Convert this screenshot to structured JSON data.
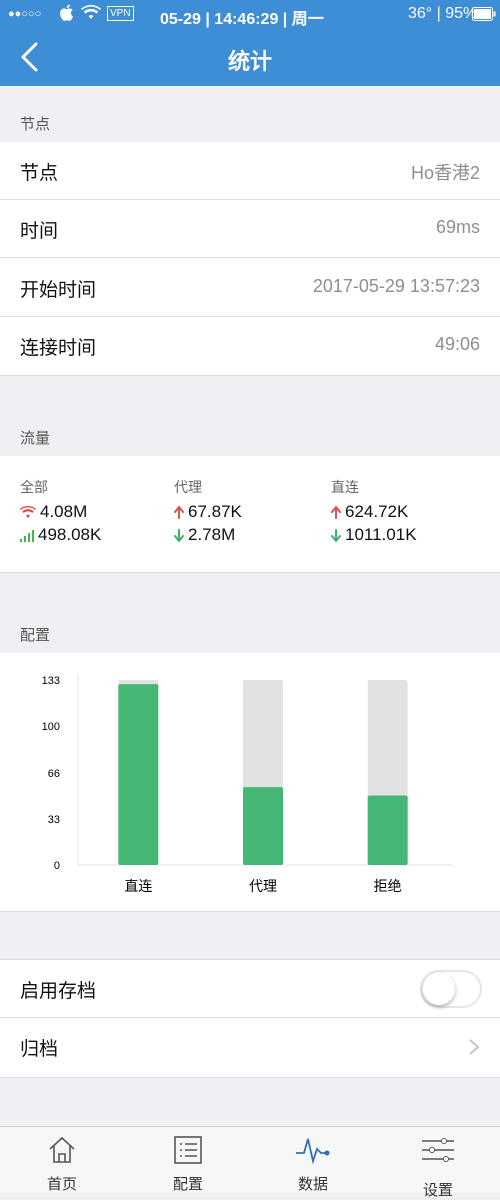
{
  "status": {
    "carrier_dots": "●●○○○",
    "vpn": "VPN",
    "datetime": "05-29 | 14:46:29 | 周一",
    "temp_battery": "36° | 95%"
  },
  "nav": {
    "title": "统计"
  },
  "node_section": {
    "header": "节点",
    "rows": [
      {
        "label": "节点",
        "value": "Ho香港2"
      },
      {
        "label": "时间",
        "value": "69ms"
      },
      {
        "label": "开始时间",
        "value": "2017-05-29 13:57:23"
      },
      {
        "label": "连接时间",
        "value": "49:06"
      }
    ]
  },
  "traffic_section": {
    "header": "流量",
    "columns": [
      {
        "title": "全部",
        "line1": "4.08M",
        "line2": "498.08K"
      },
      {
        "title": "代理",
        "line1": "67.87K",
        "line2": "2.78M"
      },
      {
        "title": "直连",
        "line1": "624.72K",
        "line2": "1011.01K"
      }
    ],
    "colors": {
      "up": "#d9534f",
      "down": "#3cb371",
      "wifi": "#e0463c",
      "cell": "#4caf50"
    }
  },
  "config_section": {
    "header": "配置"
  },
  "chart_data": {
    "type": "bar",
    "categories": [
      "直连",
      "代理",
      "拒绝"
    ],
    "values": [
      130,
      56,
      50
    ],
    "capacity": [
      133,
      133,
      133
    ],
    "ytick_labels": [
      "133",
      "100",
      "66",
      "33",
      "0"
    ],
    "yticks": [
      133,
      100,
      66,
      33,
      0
    ],
    "ylim": [
      0,
      133
    ],
    "colors": {
      "bar": "#46b676",
      "track": "#e2e2e4"
    }
  },
  "archive_section": {
    "rows": [
      {
        "label": "启用存档",
        "toggle_on": false
      },
      {
        "label": "归档"
      }
    ]
  },
  "tabbar": {
    "items": [
      {
        "label": "首页",
        "icon": "home-icon"
      },
      {
        "label": "配置",
        "icon": "list-icon"
      },
      {
        "label": "数据",
        "icon": "pulse-icon"
      },
      {
        "label": "设置",
        "icon": "sliders-icon"
      }
    ],
    "active_color": "#2f6fb5"
  }
}
